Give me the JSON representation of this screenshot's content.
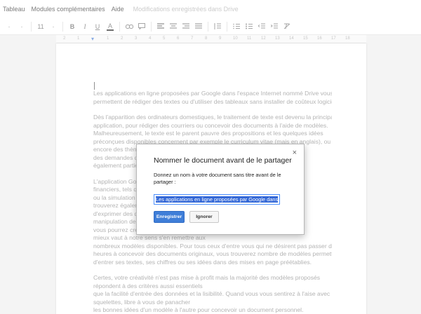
{
  "menubar": {
    "items": [
      "Tableau",
      "Modules complémentaires",
      "Aide"
    ],
    "status": "Modifications enregistrées dans Drive"
  },
  "toolbar": {
    "font_size_hint": "11",
    "bold": "B",
    "italic": "I",
    "underline": "U",
    "text_color": "A"
  },
  "ruler": {
    "marks": [
      "2",
      "1",
      "",
      "1",
      "2",
      "3",
      "4",
      "5",
      "6",
      "7",
      "8",
      "9",
      "10",
      "11",
      "12",
      "13",
      "14",
      "15",
      "16",
      "17",
      "18"
    ]
  },
  "document": {
    "paragraphs": [
      [
        "Les applications en ligne proposées par Google dans l'espace Internet nommé Drive vous",
        "permettent de rédiger des textes ou d'utiliser des tableaux sans installer de coûteux logiciels."
      ],
      [
        "Dès l'apparition des ordinateurs domestiques, le traitement de texte est devenu la principale",
        "application, pour rédiger des courriers ou concevoir des documents à l'aide de modèles.",
        "Malheureusement, le texte est le parent pauvre des propositions et les quelques idées",
        "préconçues disponibles concernent par exemple le curriculum vitae (mais en anglais), ou",
        "encore des thèmes                                                                    de pole,",
        "des demandes d                                                                       offrent",
        "également partie"
      ],
      [
        "L'application Goo                                                                   calculs",
        "financiers, tels q",
        "ou la simulation o                                                                   vous",
        "trouverez égalem",
        "d'exprimer des d                                                                    dans la",
        "manipulation des",
        "vous pourrez cré                                                                     ndant,",
        "mieux vaut à notre sens s'en remettre aux",
        "nombreux modèles disponibles. Pour tous ceux d'entre vous qui ne désirent pas passer des",
        "heures à concevoir des documents originaux, vous trouverez nombre de modèles permettant",
        "d'entrer ses textes, ses chiffres ou ses idées dans des mises en page préétablies."
      ],
      [
        "Certes, votre créativité n'est pas mise à profit mais la majorité des modèles proposés",
        "répondent à des critères aussi essentiels",
        "que la facilité d'entrée des données et la lisibilité. Quand vous vous sentirez à l'aise avec ces",
        "squelettes, libre à vous de panacher",
        "les bonnes idées d'un modèle à l'autre pour concevoir un document personnel."
      ]
    ]
  },
  "dialog": {
    "title": "Nommer le document avant de le partager",
    "close": "×",
    "description": "Donnez un nom à votre document sans titre avant de le partager :",
    "input_value": "Les applications en ligne proposées par Google dans",
    "save_label": "Enregistrer",
    "ignore_label": "Ignorer"
  },
  "colors": {
    "primary_button": "#3f7ed8",
    "input_focus": "#4d90fe",
    "selection": "#3367d6"
  }
}
